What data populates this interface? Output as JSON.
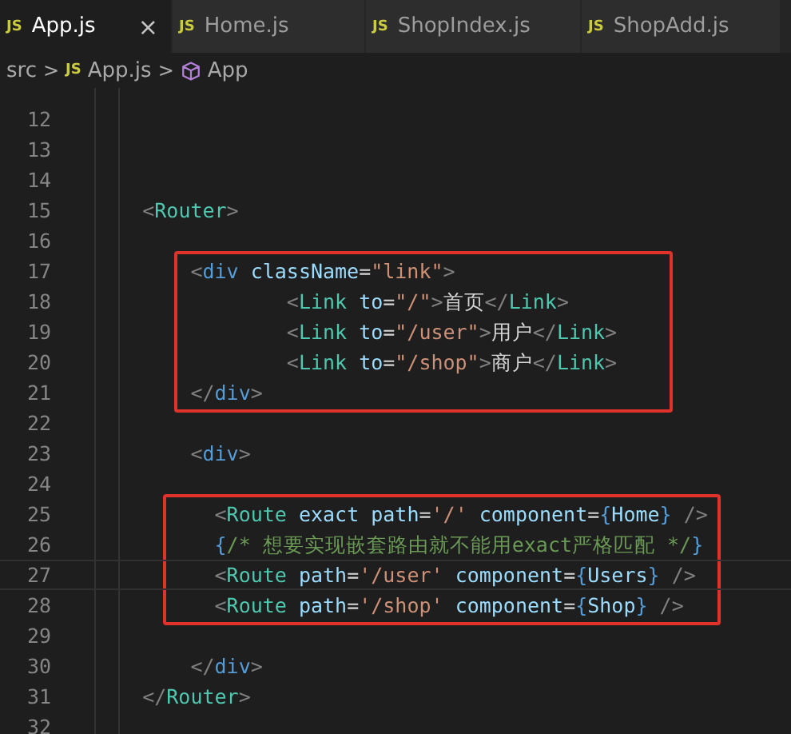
{
  "tabs": [
    {
      "icon_text": "JS",
      "label": "App.js",
      "selected": true,
      "close": "×"
    },
    {
      "icon_text": "JS",
      "label": "Home.js",
      "selected": false
    },
    {
      "icon_text": "JS",
      "label": "ShopIndex.js",
      "selected": false
    },
    {
      "icon_text": "JS",
      "label": "ShopAdd.js",
      "selected": false
    }
  ],
  "breadcrumb": [
    {
      "kind": "folder",
      "label": "src"
    },
    {
      "kind": "file",
      "icon_text": "JS",
      "label": "App.js"
    },
    {
      "kind": "symbol",
      "label": "App"
    }
  ],
  "breadcrumb_separator": ">",
  "code_blocks": [
    {
      "highlighted": false,
      "lines": [
        {
          "number": "12",
          "current": false
        },
        {
          "number": "13",
          "current": false
        },
        {
          "number": "14",
          "current": false
        },
        {
          "number": "15",
          "current": false,
          "tokens": [
            {
              "kind": "punct",
              "text": "    <"
            },
            {
              "kind": "component",
              "text": "Router"
            },
            {
              "kind": "punct",
              "text": ">"
            }
          ]
        },
        {
          "number": "16",
          "current": false
        }
      ]
    },
    {
      "highlighted": true,
      "lines": [
        {
          "number": "17",
          "current": false,
          "tokens": [
            {
              "kind": "punct",
              "text": "        <"
            },
            {
              "kind": "tag",
              "text": "div"
            },
            {
              "kind": "attr",
              "text": " className"
            },
            {
              "kind": "plain",
              "text": "="
            },
            {
              "kind": "string",
              "text": "\"link\""
            },
            {
              "kind": "punct",
              "text": ">"
            }
          ]
        },
        {
          "number": "18",
          "current": false,
          "tokens": [
            {
              "kind": "punct",
              "text": "                <"
            },
            {
              "kind": "component",
              "text": "Link"
            },
            {
              "kind": "attr",
              "text": " to"
            },
            {
              "kind": "plain",
              "text": "="
            },
            {
              "kind": "string",
              "text": "\"/\""
            },
            {
              "kind": "punct",
              "text": ">"
            },
            {
              "kind": "plain",
              "text": "首页"
            },
            {
              "kind": "punct",
              "text": "</"
            },
            {
              "kind": "component",
              "text": "Link"
            },
            {
              "kind": "punct",
              "text": ">"
            }
          ]
        },
        {
          "number": "19",
          "current": false,
          "tokens": [
            {
              "kind": "punct",
              "text": "                <"
            },
            {
              "kind": "component",
              "text": "Link"
            },
            {
              "kind": "attr",
              "text": " to"
            },
            {
              "kind": "plain",
              "text": "="
            },
            {
              "kind": "string",
              "text": "\"/user\""
            },
            {
              "kind": "punct",
              "text": ">"
            },
            {
              "kind": "plain",
              "text": "用户"
            },
            {
              "kind": "punct",
              "text": "</"
            },
            {
              "kind": "component",
              "text": "Link"
            },
            {
              "kind": "punct",
              "text": ">"
            }
          ]
        },
        {
          "number": "20",
          "current": false,
          "tokens": [
            {
              "kind": "punct",
              "text": "                <"
            },
            {
              "kind": "component",
              "text": "Link"
            },
            {
              "kind": "attr",
              "text": " to"
            },
            {
              "kind": "plain",
              "text": "="
            },
            {
              "kind": "string",
              "text": "\"/shop\""
            },
            {
              "kind": "punct",
              "text": ">"
            },
            {
              "kind": "plain",
              "text": "商户"
            },
            {
              "kind": "punct",
              "text": "</"
            },
            {
              "kind": "component",
              "text": "Link"
            },
            {
              "kind": "punct",
              "text": ">"
            }
          ]
        },
        {
          "number": "21",
          "current": false,
          "tokens": [
            {
              "kind": "punct",
              "text": "        </"
            },
            {
              "kind": "tag",
              "text": "div"
            },
            {
              "kind": "punct",
              "text": ">"
            }
          ]
        }
      ]
    },
    {
      "highlighted": false,
      "lines": [
        {
          "number": "22",
          "current": false
        },
        {
          "number": "23",
          "current": false,
          "tokens": [
            {
              "kind": "punct",
              "text": "        <"
            },
            {
              "kind": "tag",
              "text": "div"
            },
            {
              "kind": "punct",
              "text": ">"
            }
          ]
        },
        {
          "number": "24",
          "current": false
        }
      ]
    },
    {
      "highlighted": true,
      "lines": [
        {
          "number": "25",
          "current": false,
          "tokens": [
            {
              "kind": "punct",
              "text": "          <"
            },
            {
              "kind": "component",
              "text": "Route"
            },
            {
              "kind": "attr",
              "text": " exact path"
            },
            {
              "kind": "plain",
              "text": "="
            },
            {
              "kind": "string",
              "text": "'/'"
            },
            {
              "kind": "attr",
              "text": " component"
            },
            {
              "kind": "plain",
              "text": "="
            },
            {
              "kind": "brace",
              "text": "{"
            },
            {
              "kind": "var",
              "text": "Home"
            },
            {
              "kind": "brace",
              "text": "}"
            },
            {
              "kind": "punct",
              "text": " />"
            }
          ]
        },
        {
          "number": "26",
          "current": false,
          "tokens": [
            {
              "kind": "brace",
              "text": "          {"
            },
            {
              "kind": "comment",
              "text": "/* 想要实现嵌套路由就不能用exact严格匹配 */"
            },
            {
              "kind": "brace",
              "text": "}"
            }
          ]
        },
        {
          "number": "27",
          "current": true,
          "tokens": [
            {
              "kind": "punct",
              "text": "          <"
            },
            {
              "kind": "component",
              "text": "Route"
            },
            {
              "kind": "attr",
              "text": " path"
            },
            {
              "kind": "plain",
              "text": "="
            },
            {
              "kind": "string",
              "text": "'/user'"
            },
            {
              "kind": "attr",
              "text": " component"
            },
            {
              "kind": "plain",
              "text": "="
            },
            {
              "kind": "brace",
              "text": "{"
            },
            {
              "kind": "var",
              "text": "Users"
            },
            {
              "kind": "brace",
              "text": "}"
            },
            {
              "kind": "punct",
              "text": " />"
            }
          ]
        },
        {
          "number": "28",
          "current": false,
          "tokens": [
            {
              "kind": "punct",
              "text": "          <"
            },
            {
              "kind": "component",
              "text": "Route"
            },
            {
              "kind": "attr",
              "text": " path"
            },
            {
              "kind": "plain",
              "text": "="
            },
            {
              "kind": "string",
              "text": "'/shop'"
            },
            {
              "kind": "attr",
              "text": " component"
            },
            {
              "kind": "plain",
              "text": "="
            },
            {
              "kind": "brace",
              "text": "{"
            },
            {
              "kind": "var",
              "text": "Shop"
            },
            {
              "kind": "brace",
              "text": "}"
            },
            {
              "kind": "punct",
              "text": " />"
            }
          ]
        }
      ]
    },
    {
      "highlighted": false,
      "lines": [
        {
          "number": "29",
          "current": false
        },
        {
          "number": "30",
          "current": false,
          "tokens": [
            {
              "kind": "punct",
              "text": "        </"
            },
            {
              "kind": "tag",
              "text": "div"
            },
            {
              "kind": "punct",
              "text": ">"
            }
          ]
        },
        {
          "number": "31",
          "current": false,
          "tokens": [
            {
              "kind": "punct",
              "text": "    </"
            },
            {
              "kind": "component",
              "text": "Router"
            },
            {
              "kind": "punct",
              "text": ">"
            }
          ]
        },
        {
          "number": "32",
          "current": false
        }
      ]
    }
  ]
}
